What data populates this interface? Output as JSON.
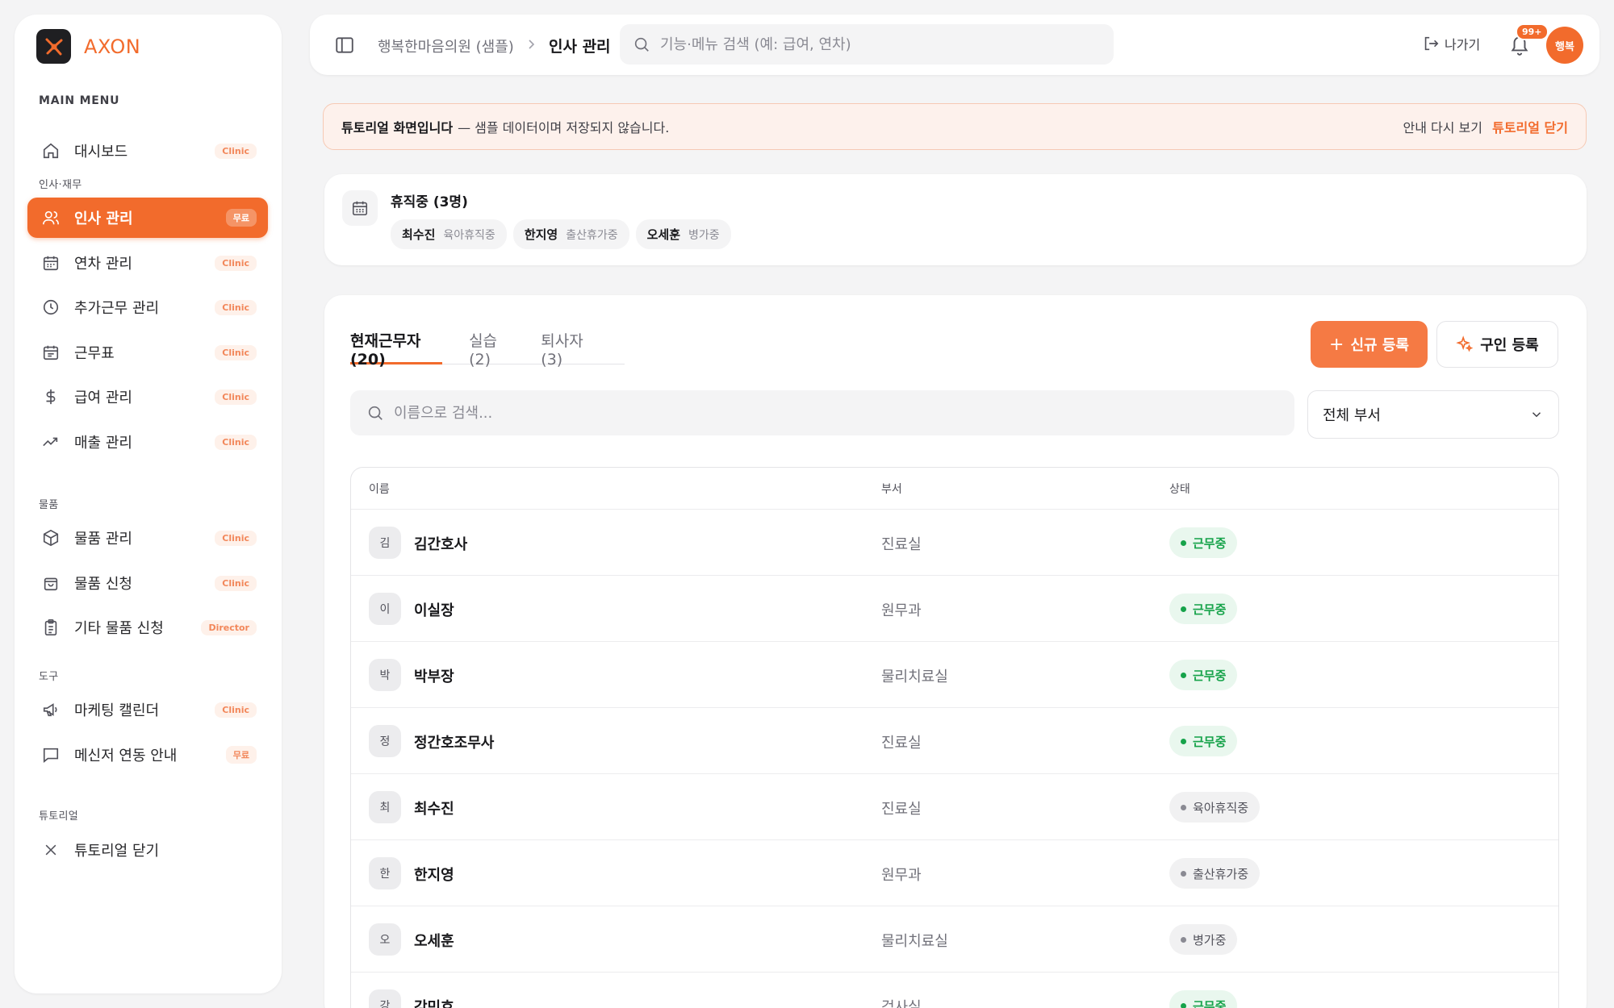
{
  "brand": {
    "name": "AXON"
  },
  "sidebar": {
    "main_menu_label": "MAIN MENU",
    "sections": {
      "hr": "인사·재무",
      "supplies": "물품",
      "tools": "도구",
      "tutorial": "튜토리얼"
    },
    "items": [
      {
        "label": "대시보드",
        "tag": "Clinic",
        "icon": "home-icon"
      },
      {
        "label": "인사 관리",
        "tag": "무료",
        "icon": "users-icon",
        "active": true
      },
      {
        "label": "연차 관리",
        "tag": "Clinic",
        "icon": "calendar-icon"
      },
      {
        "label": "추가근무 관리",
        "tag": "Clinic",
        "icon": "clock-icon"
      },
      {
        "label": "근무표",
        "tag": "Clinic",
        "icon": "calendar-grid-icon"
      },
      {
        "label": "급여 관리",
        "tag": "Clinic",
        "icon": "dollar-icon"
      },
      {
        "label": "매출 관리",
        "tag": "Clinic",
        "icon": "trend-up-icon"
      },
      {
        "label": "물품 관리",
        "tag": "Clinic",
        "icon": "box-icon"
      },
      {
        "label": "물품 신청",
        "tag": "Clinic",
        "icon": "bag-icon"
      },
      {
        "label": "기타 물품 신청",
        "tag": "Director",
        "icon": "clipboard-icon"
      },
      {
        "label": "마케팅 캘린더",
        "tag": "Clinic",
        "icon": "megaphone-icon"
      },
      {
        "label": "메신저 연동 안내",
        "tag": "무료",
        "icon": "message-icon"
      },
      {
        "label": "튜토리얼 닫기",
        "icon": "close-icon"
      }
    ]
  },
  "header": {
    "breadcrumb_parent": "행복한마음의원 (샘플)",
    "breadcrumb_current": "인사 관리",
    "search_placeholder": "기능·메뉴 검색 (예: 급여, 연차)",
    "exit_label": "나가기",
    "notification_badge": "99+",
    "avatar_text": "행복"
  },
  "banner": {
    "title": "튜토리얼 화면입니다",
    "text": "— 샘플 데이터이며 저장되지 않습니다.",
    "show_again": "안내 다시 보기",
    "close": "튜토리얼 닫기"
  },
  "leave": {
    "title": "휴직중 (3명)",
    "people": [
      {
        "name": "최수진",
        "status": "육아휴직중"
      },
      {
        "name": "한지영",
        "status": "출산휴가중"
      },
      {
        "name": "오세훈",
        "status": "병가중"
      }
    ]
  },
  "main": {
    "tabs": [
      {
        "label": "현재근무자 (20)",
        "active": true
      },
      {
        "label": "실습 (2)"
      },
      {
        "label": "퇴사자 (3)"
      }
    ],
    "new_button": "신규 등록",
    "job_button": "구인 등록",
    "search_placeholder": "이름으로 검색...",
    "dept_select": "전체 부서",
    "columns": {
      "name": "이름",
      "dept": "부서",
      "status": "상태"
    },
    "rows": [
      {
        "initial": "김",
        "name": "김간호사",
        "dept": "진료실",
        "status": "근무중",
        "kind": "working"
      },
      {
        "initial": "이",
        "name": "이실장",
        "dept": "원무과",
        "status": "근무중",
        "kind": "working"
      },
      {
        "initial": "박",
        "name": "박부장",
        "dept": "물리치료실",
        "status": "근무중",
        "kind": "working"
      },
      {
        "initial": "정",
        "name": "정간호조무사",
        "dept": "진료실",
        "status": "근무중",
        "kind": "working"
      },
      {
        "initial": "최",
        "name": "최수진",
        "dept": "진료실",
        "status": "육아휴직중",
        "kind": "leave"
      },
      {
        "initial": "한",
        "name": "한지영",
        "dept": "원무과",
        "status": "출산휴가중",
        "kind": "leave"
      },
      {
        "initial": "오",
        "name": "오세훈",
        "dept": "물리치료실",
        "status": "병가중",
        "kind": "leave"
      },
      {
        "initial": "강",
        "name": "강민호",
        "dept": "검사실",
        "status": "근무중",
        "kind": "working"
      }
    ]
  },
  "colors": {
    "accent": "#f26b2c",
    "working": "#16a34a"
  }
}
